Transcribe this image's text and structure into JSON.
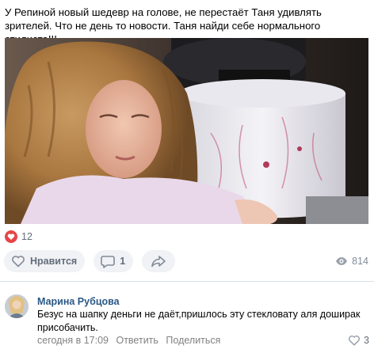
{
  "post": {
    "text": "У Репиной новый шедевр на голове, не перестаёт Таня удивлять зрителей. Что не день то новости. Таня найди себе нормального стилиста!!!"
  },
  "reactions": {
    "likes_count": "12"
  },
  "actions": {
    "like_label": "Нравится",
    "comments_count": "1",
    "views_count": "814"
  },
  "comment": {
    "author": "Марина Рубцова",
    "text": "Безус на шапку деньги не даёт,пришлось эту стекловату аля доширак присобачить.",
    "time": "сегодня в 17:09",
    "reply_label": "Ответить",
    "share_label": "Поделиться",
    "likes_count": "3"
  },
  "colors": {
    "like_red": "#e64646",
    "link_blue": "#2a5885",
    "muted_gray": "#828282",
    "button_bg": "#f0f2f5"
  }
}
